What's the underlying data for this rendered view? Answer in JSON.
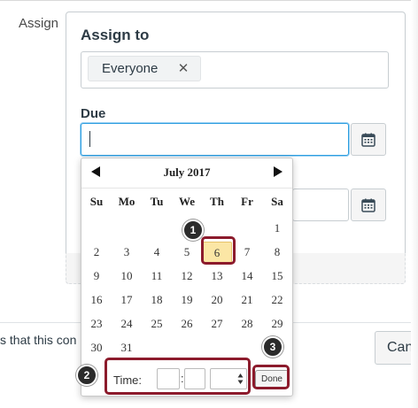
{
  "form": {
    "assign_label": "Assign",
    "assign_to_heading": "Assign to",
    "assignee_token": "Everyone",
    "remove_glyph": "✕",
    "due_heading": "Due",
    "due_value": "",
    "notify_text": "s that this con",
    "cancel_label": "Can"
  },
  "datepicker": {
    "month_label": "July 2017",
    "weekdays": [
      "Su",
      "Mo",
      "Tu",
      "We",
      "Th",
      "Fr",
      "Sa"
    ],
    "weeks": [
      [
        "",
        "",
        "",
        "",
        "",
        "",
        "1"
      ],
      [
        "2",
        "3",
        "4",
        "5",
        "6",
        "7",
        "8"
      ],
      [
        "9",
        "10",
        "11",
        "12",
        "13",
        "14",
        "15"
      ],
      [
        "16",
        "17",
        "18",
        "19",
        "20",
        "21",
        "22"
      ],
      [
        "23",
        "24",
        "25",
        "26",
        "27",
        "28",
        "29"
      ],
      [
        "30",
        "31",
        "",
        "",
        "",
        "",
        ""
      ]
    ],
    "selected_day": "6",
    "time_label": "Time:",
    "time_separator": ":",
    "hour_value": "",
    "minute_value": "",
    "ampm_value": "",
    "done_label": "Done"
  },
  "callouts": [
    "1",
    "2",
    "3"
  ],
  "icons": {
    "calendar": "calendar-icon",
    "prev": "triangle-left-icon",
    "next": "triangle-right-icon",
    "remove": "close-icon"
  },
  "colors": {
    "highlight": "#8c1b2c",
    "selected_day_bg": "#fbe6a5",
    "focus_border": "#2d9ee0",
    "callout_bg": "#2b2b2b"
  }
}
